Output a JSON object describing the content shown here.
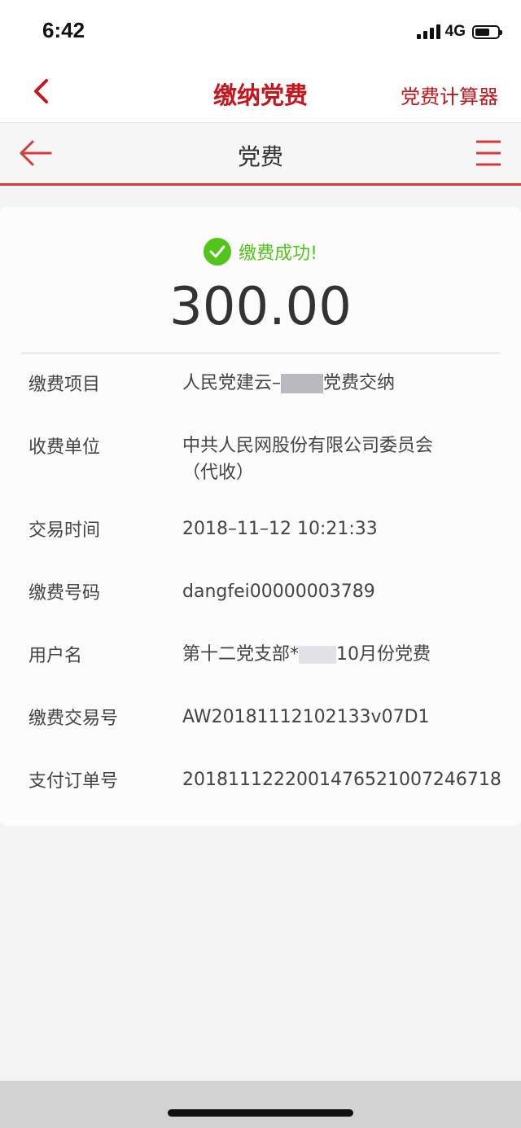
{
  "status": {
    "time": "6:42",
    "network": "4G",
    "battery_level": 0.65
  },
  "nav": {
    "title": "缴纳党费",
    "right_label": "党费计算器",
    "back_icon": "chevron-left-icon",
    "accent_color": "#c4161c"
  },
  "sub_header": {
    "title": "党费",
    "back_icon": "arrow-left-icon",
    "menu_icon": "hamburger-menu-icon",
    "accent_color": "#d83a3a"
  },
  "payment": {
    "status_text": "缴费成功!",
    "status_color": "#52c41a",
    "amount": "300.00",
    "details": [
      {
        "label": "缴费项目",
        "value_prefix": "人民党建云–",
        "value_suffix": "党费交纳"
      },
      {
        "label": "收费单位",
        "value": "中共人民网股份有限公司委员会",
        "value_line2": "（代收）"
      },
      {
        "label": "交易时间",
        "value": "2018–11–12 10:21:33"
      },
      {
        "label": "缴费号码",
        "value": "dangfei00000003789"
      },
      {
        "label": "用户名",
        "value_prefix": "第十二党支部*",
        "value_suffix": "10月份党费"
      },
      {
        "label": "缴费交易号",
        "value": "AW20181112102133v07D1"
      },
      {
        "label": "支付订单号",
        "value": "2018111222001476521007246718"
      }
    ]
  }
}
